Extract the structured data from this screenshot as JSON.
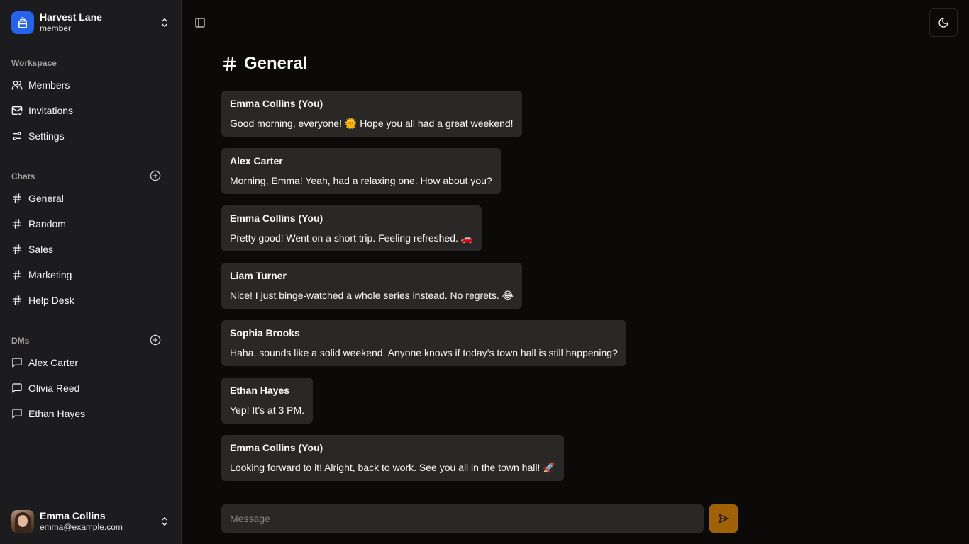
{
  "team": {
    "name": "Harvest Lane",
    "role": "member"
  },
  "workspace": {
    "label": "Workspace",
    "items": [
      {
        "label": "Members",
        "icon": "users-icon"
      },
      {
        "label": "Invitations",
        "icon": "mail-check-icon"
      },
      {
        "label": "Settings",
        "icon": "settings-sliders-icon"
      }
    ]
  },
  "chats": {
    "label": "Chats",
    "items": [
      {
        "label": "General"
      },
      {
        "label": "Random"
      },
      {
        "label": "Sales"
      },
      {
        "label": "Marketing"
      },
      {
        "label": "Help Desk"
      }
    ]
  },
  "dms": {
    "label": "DMs",
    "items": [
      {
        "label": "Alex Carter"
      },
      {
        "label": "Olivia Reed"
      },
      {
        "label": "Ethan Hayes"
      }
    ]
  },
  "user": {
    "name": "Emma Collins",
    "email": "emma@example.com"
  },
  "channel": {
    "title": "General"
  },
  "messages": [
    {
      "author": "Emma Collins (You)",
      "text": "Good morning, everyone! 🌞 Hope you all had a great weekend!"
    },
    {
      "author": "Alex Carter",
      "text": "Morning, Emma! Yeah, had a relaxing one. How about you?"
    },
    {
      "author": "Emma Collins (You)",
      "text": "Pretty good! Went on a short trip. Feeling refreshed. 🚗"
    },
    {
      "author": "Liam Turner",
      "text": "Nice! I just binge-watched a whole series instead. No regrets. 😂"
    },
    {
      "author": "Sophia Brooks",
      "text": "Haha, sounds like a solid weekend. Anyone knows if today’s town hall is still happening?"
    },
    {
      "author": "Ethan Hayes",
      "text": "Yep! It’s at 3 PM."
    },
    {
      "author": "Emma Collins (You)",
      "text": "Looking forward to it! Alright, back to work. See you all in the town hall! 🚀"
    }
  ],
  "composer": {
    "placeholder": "Message"
  },
  "colors": {
    "accent": "#2563eb",
    "send": "#a16207",
    "bubble": "#2a2827",
    "sidebar": "#1c1b1e",
    "background": "#0c0a09"
  }
}
